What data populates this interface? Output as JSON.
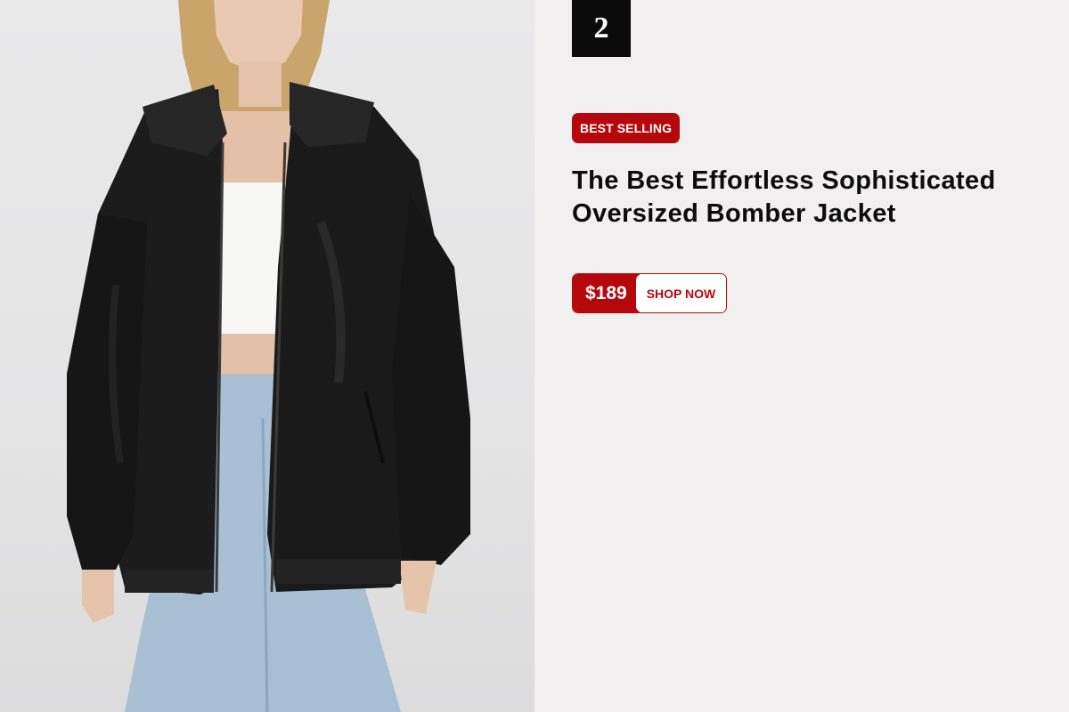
{
  "product": {
    "rank": "2",
    "badge": "BEST SELLING",
    "title": "The Best Effortless Sophisticated Oversized Bomber Jacket",
    "price": "$189",
    "cta_label": "SHOP NOW"
  },
  "colors": {
    "accent": "#b5080c",
    "background": "#f1eff0",
    "rank_box": "#0b0b0b",
    "jacket": "#1c1c1c",
    "denim": "#a9bfd4"
  },
  "image": {
    "subject": "model-wearing-black-leather-bomber-jacket"
  }
}
